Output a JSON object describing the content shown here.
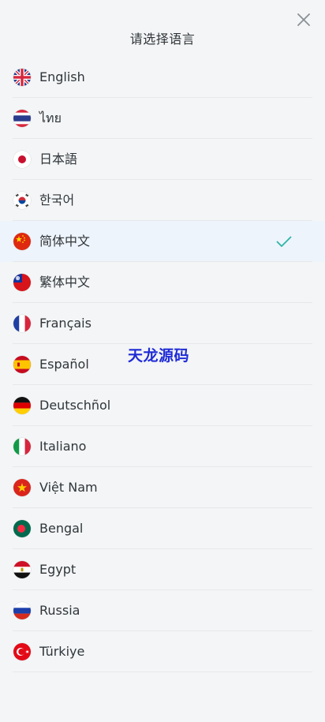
{
  "header": {
    "title": "请选择语言"
  },
  "languages": [
    {
      "label": "English",
      "flag": "united-kingdom-flag",
      "selected": false
    },
    {
      "label": "ไทย",
      "flag": "thailand-flag",
      "selected": false
    },
    {
      "label": "日本語",
      "flag": "japan-flag",
      "selected": false
    },
    {
      "label": "한국어",
      "flag": "south-korea-flag",
      "selected": false
    },
    {
      "label": "简体中文",
      "flag": "china-flag",
      "selected": true
    },
    {
      "label": "繁体中文",
      "flag": "taiwan-flag",
      "selected": false
    },
    {
      "label": "Français",
      "flag": "france-flag",
      "selected": false
    },
    {
      "label": "Español",
      "flag": "spain-flag",
      "selected": false
    },
    {
      "label": "Deutschñol",
      "flag": "germany-flag",
      "selected": false
    },
    {
      "label": "Italiano",
      "flag": "italy-flag",
      "selected": false
    },
    {
      "label": "Việt Nam",
      "flag": "vietnam-flag",
      "selected": false
    },
    {
      "label": "Bengal",
      "flag": "bangladesh-flag",
      "selected": false
    },
    {
      "label": "Egypt",
      "flag": "egypt-flag",
      "selected": false
    },
    {
      "label": "Russia",
      "flag": "russia-flag",
      "selected": false
    },
    {
      "label": "Türkiye",
      "flag": "turkey-flag",
      "selected": false
    }
  ],
  "watermark": "天龙源码",
  "colors": {
    "background": "#f3f5f6",
    "selected_row": "#eef4fb",
    "check": "#2bb5a8",
    "watermark": "#1f2bd6"
  }
}
